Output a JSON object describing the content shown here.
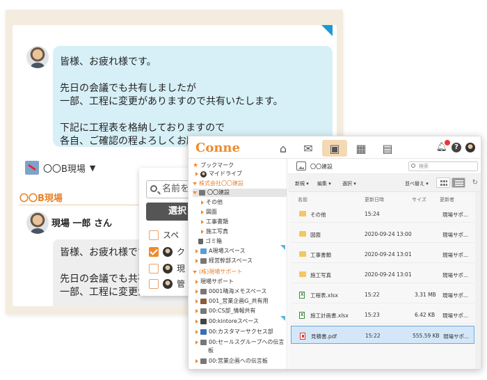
{
  "chat": {
    "message1": {
      "lines": [
        "皆様、お疲れ様です。",
        "先日の会議でも共有しましたが",
        "一部、工程に変更がありますので共有いたします。",
        "下記に工程表を格納しておりますので",
        "各自、ご確認の程よろしくお願いいたします。"
      ]
    },
    "room_selector": "〇〇B現場",
    "room_title": "〇〇B現場",
    "sender": "現場 一郎 さん",
    "message2": {
      "lines": [
        "皆様、お疲れ様です。",
        "先日の会議でも共有し",
        "一部、工程に変更があ"
      ]
    }
  },
  "popup": {
    "search_placeholder": "名前を",
    "select_button": "選択",
    "rows": [
      "スペ",
      "ク",
      "現",
      "管"
    ]
  },
  "file_manager": {
    "logo": "Conne",
    "sidebar": [
      {
        "label": "ブックマーク",
        "kind": "star"
      },
      {
        "label": "マイドライブ",
        "kind": "avatar"
      },
      {
        "label": "株式会社〇〇建設",
        "kind": "group"
      },
      {
        "label": "〇〇建設",
        "kind": "folder",
        "selected": true
      },
      {
        "label": "その他",
        "kind": "child"
      },
      {
        "label": "図面",
        "kind": "child"
      },
      {
        "label": "工事書類",
        "kind": "child"
      },
      {
        "label": "施工写真",
        "kind": "child"
      },
      {
        "label": "ゴミ箱",
        "kind": "trash"
      },
      {
        "label": "A現場スペース",
        "kind": "space"
      },
      {
        "label": "経営幹部スペース",
        "kind": "space"
      },
      {
        "label": "(株)現場サポート",
        "kind": "group"
      },
      {
        "label": "現場サポート",
        "kind": "child"
      },
      {
        "label": "0001晴海メモスペース",
        "kind": "space"
      },
      {
        "label": "001_営業企画G_共有用",
        "kind": "space"
      },
      {
        "label": "00:CS部_情報共有",
        "kind": "space"
      },
      {
        "label": "00:kintoreスペース",
        "kind": "space"
      },
      {
        "label": "00:カスタマーサクセス部",
        "kind": "space"
      },
      {
        "label": "00:セールスグループへの伝言",
        "kind": "space"
      },
      {
        "label": "板",
        "kind": "cont"
      },
      {
        "label": "00:営業企画への伝言板",
        "kind": "space"
      }
    ],
    "breadcrumb": "〇〇建設",
    "search_placeholder": "検索",
    "toolbar": {
      "new": "新規",
      "edit": "編集",
      "select": "選択",
      "sort": "並べ替え"
    },
    "columns": {
      "name": "名前",
      "updated": "更新日時",
      "size": "サイズ",
      "updater": "更新者"
    },
    "files": [
      {
        "name": "その他",
        "updated": "15:24",
        "size": "",
        "updater": "現場サポ...",
        "type": "folder"
      },
      {
        "name": "図面",
        "updated": "2020-09-24 13:00",
        "size": "",
        "updater": "現場サポ...",
        "type": "folder"
      },
      {
        "name": "工事書類",
        "updated": "2020-09-24 13:01",
        "size": "",
        "updater": "現場サポ...",
        "type": "folder"
      },
      {
        "name": "施工写真",
        "updated": "2020-09-24 13:01",
        "size": "",
        "updater": "現場サポ...",
        "type": "folder"
      },
      {
        "name": "工程表.xlsx",
        "updated": "15:22",
        "size": "3.31 MB",
        "updater": "現場サポ...",
        "type": "xlsx"
      },
      {
        "name": "施工計画書.xlsx",
        "updated": "15:23",
        "size": "6.42 KB",
        "updater": "現場サポ...",
        "type": "xlsx"
      },
      {
        "name": "見積書.pdf",
        "updated": "15:22",
        "size": "555.59 KB",
        "updater": "現場サポ...",
        "type": "pdf",
        "selected": true
      }
    ],
    "colors": {
      "accent": "#f08a2c",
      "selection": "#d4e7f8"
    }
  }
}
